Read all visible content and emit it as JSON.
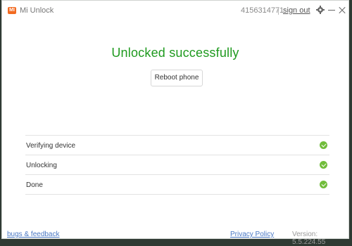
{
  "app": {
    "logo_text": "MI",
    "title": "Mi Unlock",
    "brand_color": "#f26a21"
  },
  "account": {
    "id": "4156314771",
    "sign_out_label": "sign out"
  },
  "window_controls": {
    "settings_icon": "gear-icon",
    "minimize_icon": "minimize-icon",
    "close_icon": "close-icon"
  },
  "main": {
    "status_title": "Unlocked successfully",
    "status_color": "#1f9a1f",
    "reboot_button_label": "Reboot phone"
  },
  "steps": [
    {
      "label": "Verifying device",
      "status": "done",
      "icon": "check-circle-icon"
    },
    {
      "label": "Unlocking",
      "status": "done",
      "icon": "check-circle-icon"
    },
    {
      "label": "Done",
      "status": "done",
      "icon": "check-circle-icon"
    }
  ],
  "footer": {
    "bugs_link": "bugs & feedback",
    "privacy_link": "Privacy Policy",
    "version_text": "Version: 5.5.224.55"
  }
}
